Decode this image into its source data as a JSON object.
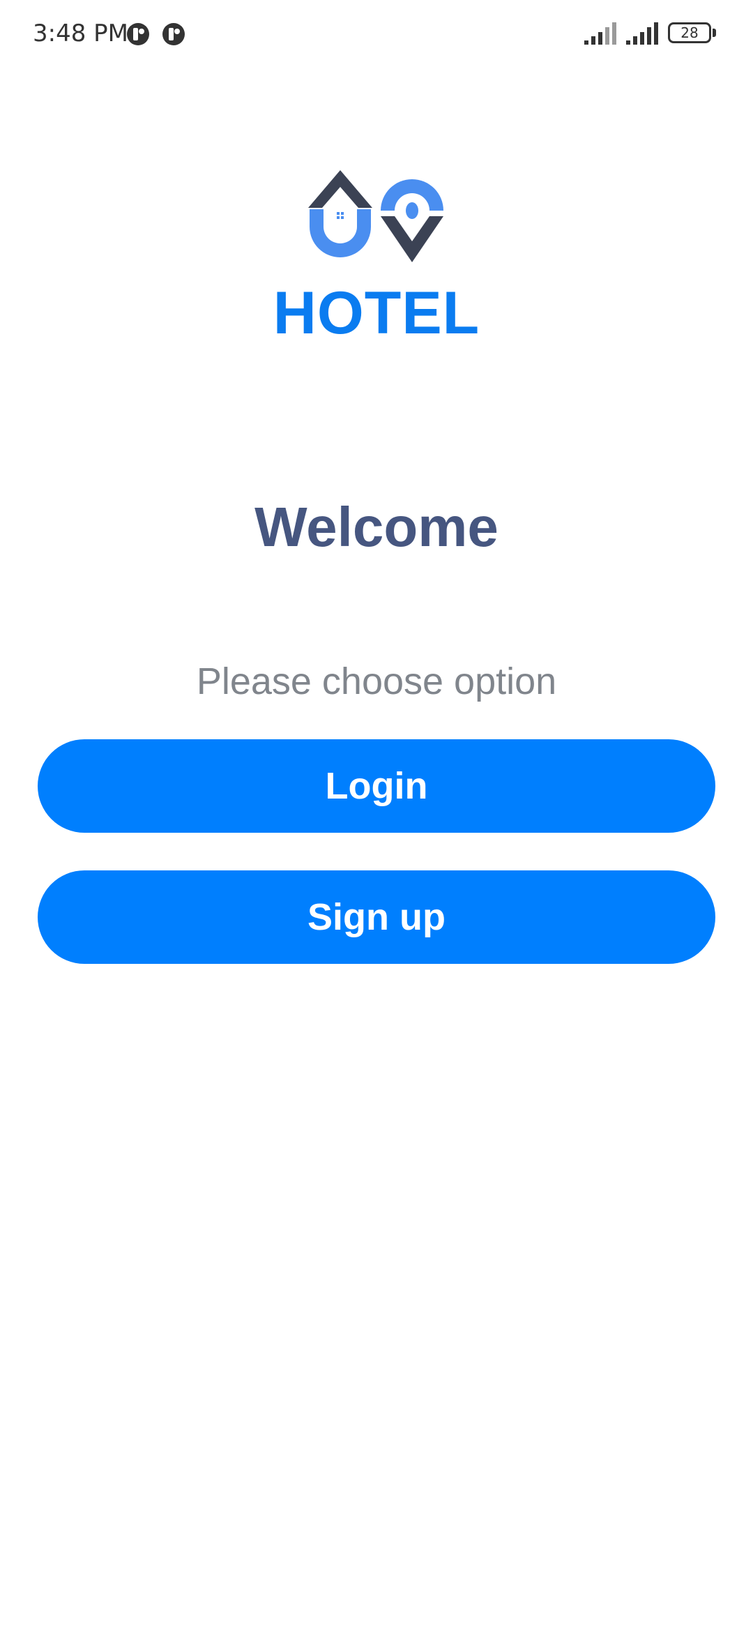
{
  "status_bar": {
    "time": "3:48 PM",
    "battery": "28",
    "notification_icons": [
      "app-notification-icon",
      "app-notification-icon"
    ],
    "signal_icons": [
      "cellular-signal-icon",
      "cellular-signal-icon"
    ]
  },
  "brand": {
    "logo_icon": "hotel-logo-icon",
    "name": "HOTEL"
  },
  "welcome": {
    "title": "Welcome",
    "subtitle": "Please choose option"
  },
  "actions": {
    "login_label": "Login",
    "signup_label": "Sign up"
  },
  "colors": {
    "primary": "#007ffe",
    "brand_text": "#0a7cf0",
    "title_text": "#465680",
    "subtitle_text": "#80858c",
    "logo_dark": "#3b4254",
    "logo_blue": "#4a8ef0"
  }
}
